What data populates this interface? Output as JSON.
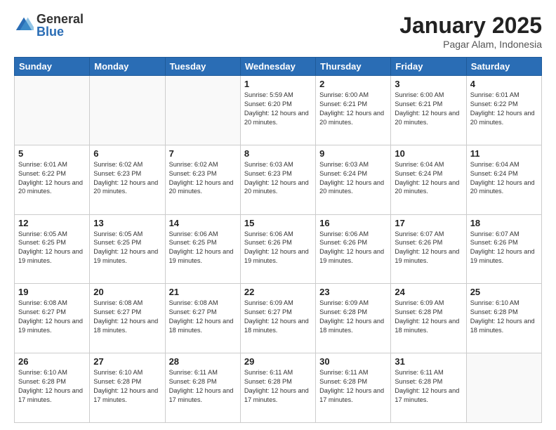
{
  "logo": {
    "general": "General",
    "blue": "Blue"
  },
  "title": "January 2025",
  "location": "Pagar Alam, Indonesia",
  "days_of_week": [
    "Sunday",
    "Monday",
    "Tuesday",
    "Wednesday",
    "Thursday",
    "Friday",
    "Saturday"
  ],
  "weeks": [
    [
      {
        "num": "",
        "info": ""
      },
      {
        "num": "",
        "info": ""
      },
      {
        "num": "",
        "info": ""
      },
      {
        "num": "1",
        "info": "Sunrise: 5:59 AM\nSunset: 6:20 PM\nDaylight: 12 hours and 20 minutes."
      },
      {
        "num": "2",
        "info": "Sunrise: 6:00 AM\nSunset: 6:21 PM\nDaylight: 12 hours and 20 minutes."
      },
      {
        "num": "3",
        "info": "Sunrise: 6:00 AM\nSunset: 6:21 PM\nDaylight: 12 hours and 20 minutes."
      },
      {
        "num": "4",
        "info": "Sunrise: 6:01 AM\nSunset: 6:22 PM\nDaylight: 12 hours and 20 minutes."
      }
    ],
    [
      {
        "num": "5",
        "info": "Sunrise: 6:01 AM\nSunset: 6:22 PM\nDaylight: 12 hours and 20 minutes."
      },
      {
        "num": "6",
        "info": "Sunrise: 6:02 AM\nSunset: 6:23 PM\nDaylight: 12 hours and 20 minutes."
      },
      {
        "num": "7",
        "info": "Sunrise: 6:02 AM\nSunset: 6:23 PM\nDaylight: 12 hours and 20 minutes."
      },
      {
        "num": "8",
        "info": "Sunrise: 6:03 AM\nSunset: 6:23 PM\nDaylight: 12 hours and 20 minutes."
      },
      {
        "num": "9",
        "info": "Sunrise: 6:03 AM\nSunset: 6:24 PM\nDaylight: 12 hours and 20 minutes."
      },
      {
        "num": "10",
        "info": "Sunrise: 6:04 AM\nSunset: 6:24 PM\nDaylight: 12 hours and 20 minutes."
      },
      {
        "num": "11",
        "info": "Sunrise: 6:04 AM\nSunset: 6:24 PM\nDaylight: 12 hours and 20 minutes."
      }
    ],
    [
      {
        "num": "12",
        "info": "Sunrise: 6:05 AM\nSunset: 6:25 PM\nDaylight: 12 hours and 19 minutes."
      },
      {
        "num": "13",
        "info": "Sunrise: 6:05 AM\nSunset: 6:25 PM\nDaylight: 12 hours and 19 minutes."
      },
      {
        "num": "14",
        "info": "Sunrise: 6:06 AM\nSunset: 6:25 PM\nDaylight: 12 hours and 19 minutes."
      },
      {
        "num": "15",
        "info": "Sunrise: 6:06 AM\nSunset: 6:26 PM\nDaylight: 12 hours and 19 minutes."
      },
      {
        "num": "16",
        "info": "Sunrise: 6:06 AM\nSunset: 6:26 PM\nDaylight: 12 hours and 19 minutes."
      },
      {
        "num": "17",
        "info": "Sunrise: 6:07 AM\nSunset: 6:26 PM\nDaylight: 12 hours and 19 minutes."
      },
      {
        "num": "18",
        "info": "Sunrise: 6:07 AM\nSunset: 6:26 PM\nDaylight: 12 hours and 19 minutes."
      }
    ],
    [
      {
        "num": "19",
        "info": "Sunrise: 6:08 AM\nSunset: 6:27 PM\nDaylight: 12 hours and 19 minutes."
      },
      {
        "num": "20",
        "info": "Sunrise: 6:08 AM\nSunset: 6:27 PM\nDaylight: 12 hours and 18 minutes."
      },
      {
        "num": "21",
        "info": "Sunrise: 6:08 AM\nSunset: 6:27 PM\nDaylight: 12 hours and 18 minutes."
      },
      {
        "num": "22",
        "info": "Sunrise: 6:09 AM\nSunset: 6:27 PM\nDaylight: 12 hours and 18 minutes."
      },
      {
        "num": "23",
        "info": "Sunrise: 6:09 AM\nSunset: 6:28 PM\nDaylight: 12 hours and 18 minutes."
      },
      {
        "num": "24",
        "info": "Sunrise: 6:09 AM\nSunset: 6:28 PM\nDaylight: 12 hours and 18 minutes."
      },
      {
        "num": "25",
        "info": "Sunrise: 6:10 AM\nSunset: 6:28 PM\nDaylight: 12 hours and 18 minutes."
      }
    ],
    [
      {
        "num": "26",
        "info": "Sunrise: 6:10 AM\nSunset: 6:28 PM\nDaylight: 12 hours and 17 minutes."
      },
      {
        "num": "27",
        "info": "Sunrise: 6:10 AM\nSunset: 6:28 PM\nDaylight: 12 hours and 17 minutes."
      },
      {
        "num": "28",
        "info": "Sunrise: 6:11 AM\nSunset: 6:28 PM\nDaylight: 12 hours and 17 minutes."
      },
      {
        "num": "29",
        "info": "Sunrise: 6:11 AM\nSunset: 6:28 PM\nDaylight: 12 hours and 17 minutes."
      },
      {
        "num": "30",
        "info": "Sunrise: 6:11 AM\nSunset: 6:28 PM\nDaylight: 12 hours and 17 minutes."
      },
      {
        "num": "31",
        "info": "Sunrise: 6:11 AM\nSunset: 6:28 PM\nDaylight: 12 hours and 17 minutes."
      },
      {
        "num": "",
        "info": ""
      }
    ]
  ]
}
